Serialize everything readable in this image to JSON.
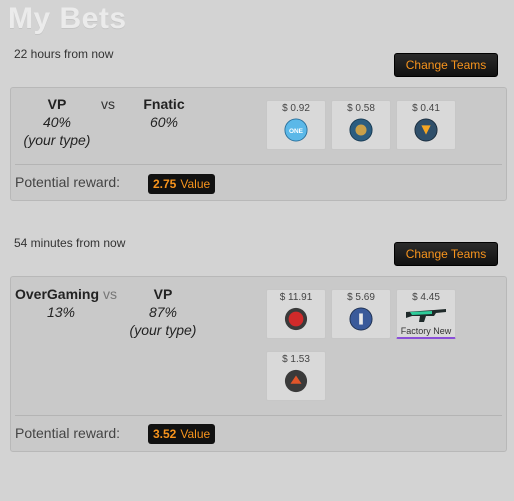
{
  "page": {
    "title": "My Bets"
  },
  "bets": [
    {
      "time": "22 hours from now",
      "change_label": "Change Teams",
      "team1": {
        "name": "VP",
        "pct": "40%",
        "note": "(your type)"
      },
      "vs": "vs",
      "team2": {
        "name": "Fnatic",
        "pct": "60%"
      },
      "items": [
        {
          "price": "$ 0.92",
          "icon": "one-logo-sticker",
          "color": "#5bb8e8"
        },
        {
          "price": "$ 0.58",
          "icon": "team-sticker",
          "color": "#4a90b8"
        },
        {
          "price": "$ 0.41",
          "icon": "fnatic-sticker",
          "color": "#f5a623"
        }
      ],
      "reward_label": "Potential reward:",
      "reward_value": "2.75",
      "reward_unit": "Value"
    },
    {
      "time": "54 minutes from now",
      "change_label": "Change Teams",
      "team1": {
        "name": "OverGaming",
        "pct": "13%"
      },
      "vs": "vs",
      "team2": {
        "name": "VP",
        "pct": "87%",
        "note": "(your type)"
      },
      "items": [
        {
          "price": "$ 11.91",
          "icon": "red-sticker",
          "color": "#d02a2a"
        },
        {
          "price": "$ 5.69",
          "icon": "blue-sticker",
          "color": "#3a5a9a"
        },
        {
          "price": "$ 4.45",
          "icon": "rifle-skin",
          "color": "#2ecc9a",
          "caption": "Factory New"
        },
        {
          "price": "$ 1.53",
          "icon": "orange-sticker",
          "color": "#e0552a"
        }
      ],
      "reward_label": "Potential reward:",
      "reward_value": "3.52",
      "reward_unit": "Value"
    }
  ]
}
